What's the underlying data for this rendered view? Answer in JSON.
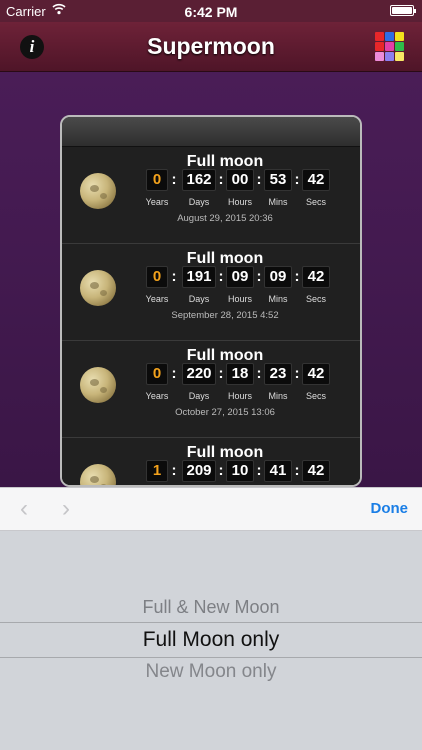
{
  "status": {
    "carrier": "Carrier",
    "time": "6:42 PM"
  },
  "nav": {
    "title": "Supermoon",
    "info_icon": "i"
  },
  "unit_labels": [
    "Years",
    "Days",
    "Hours",
    "Mins",
    "Secs"
  ],
  "events": [
    {
      "title": "Full moon",
      "years": "0",
      "days": "162",
      "hours": "00",
      "mins": "53",
      "secs": "42",
      "date": "August 29, 2015  20:36"
    },
    {
      "title": "Full moon",
      "years": "0",
      "days": "191",
      "hours": "09",
      "mins": "09",
      "secs": "42",
      "date": "September 28, 2015  4:52"
    },
    {
      "title": "Full moon",
      "years": "0",
      "days": "220",
      "hours": "18",
      "mins": "23",
      "secs": "42",
      "date": "October 27, 2015  13:06"
    },
    {
      "title": "Full moon",
      "years": "1",
      "days": "209",
      "hours": "10",
      "mins": "41",
      "secs": "42",
      "date": ""
    }
  ],
  "toolbar": {
    "prev_icon": "‹",
    "next_icon": "›",
    "done_label": "Done"
  },
  "picker": {
    "options": [
      "Full & New Moon",
      "Full Moon only",
      "New Moon only"
    ],
    "selected": "Full Moon only"
  },
  "colors": {
    "accent": "#1a7ee6",
    "years_digit": "#f3a21c",
    "nav_bar": "#5a1f34"
  }
}
